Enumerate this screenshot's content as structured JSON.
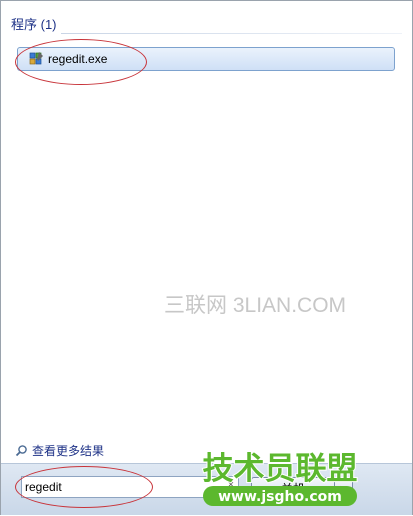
{
  "results": {
    "group_header": "程序 (1)",
    "items": [
      {
        "label": "regedit.exe",
        "icon": "regedit-icon"
      }
    ]
  },
  "watermark_text": "三联网 3LIAN.COM",
  "see_more": {
    "label": "查看更多结果",
    "icon": "search-icon"
  },
  "search": {
    "value": "regedit",
    "clear_icon": "×"
  },
  "shutdown": {
    "label": "关机",
    "arrow_icon": "▶"
  },
  "logo": {
    "title": "技术员联盟",
    "url": "www.jsgho.com"
  },
  "colors": {
    "highlight": "#c8343a",
    "logo_green": "#5cb82e",
    "selection_border": "#7da2ce",
    "link": "#1e3287"
  }
}
